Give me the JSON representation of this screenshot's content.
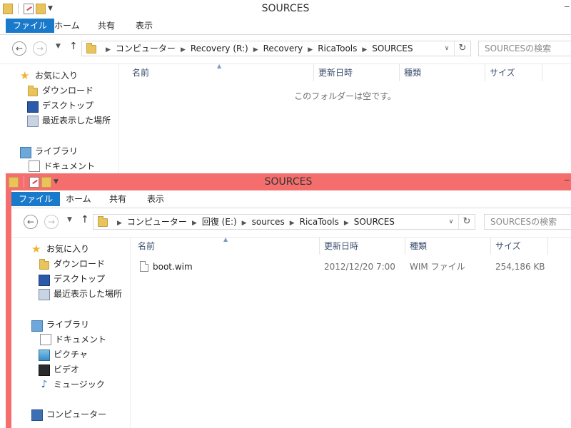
{
  "windows": [
    {
      "title": "SOURCES",
      "tabs": [
        "ファイル",
        "ホーム",
        "共有",
        "表示"
      ],
      "breadcrumb": [
        "コンピューター",
        "Recovery (R:)",
        "Recovery",
        "RicaTools",
        "SOURCES"
      ],
      "search_placeholder": "SOURCESの検索",
      "columns": [
        "名前",
        "更新日時",
        "種類",
        "サイズ"
      ],
      "empty_message": "このフォルダーは空です。",
      "nav": {
        "favorites": "お気に入り",
        "downloads": "ダウンロード",
        "desktop": "デスクトップ",
        "recent": "最近表示した場所",
        "libraries": "ライブラリ",
        "documents": "ドキュメント"
      }
    },
    {
      "title": "SOURCES",
      "tabs": [
        "ファイル",
        "ホーム",
        "共有",
        "表示"
      ],
      "breadcrumb": [
        "コンピューター",
        "回復 (E:)",
        "sources",
        "RicaTools",
        "SOURCES"
      ],
      "search_placeholder": "SOURCESの検索",
      "columns": [
        "名前",
        "更新日時",
        "種類",
        "サイズ"
      ],
      "files": [
        {
          "name": "boot.wim",
          "modified": "2012/12/20 7:00",
          "type": "WIM ファイル",
          "size": "254,186 KB"
        }
      ],
      "nav": {
        "favorites": "お気に入り",
        "downloads": "ダウンロード",
        "desktop": "デスクトップ",
        "recent": "最近表示した場所",
        "libraries": "ライブラリ",
        "documents": "ドキュメント",
        "pictures": "ピクチャ",
        "videos": "ビデオ",
        "music": "ミュージック",
        "computer": "コンピューター"
      }
    }
  ],
  "colors": {
    "accent": "#1979ca",
    "active_title_bar": "#f56e6e"
  }
}
